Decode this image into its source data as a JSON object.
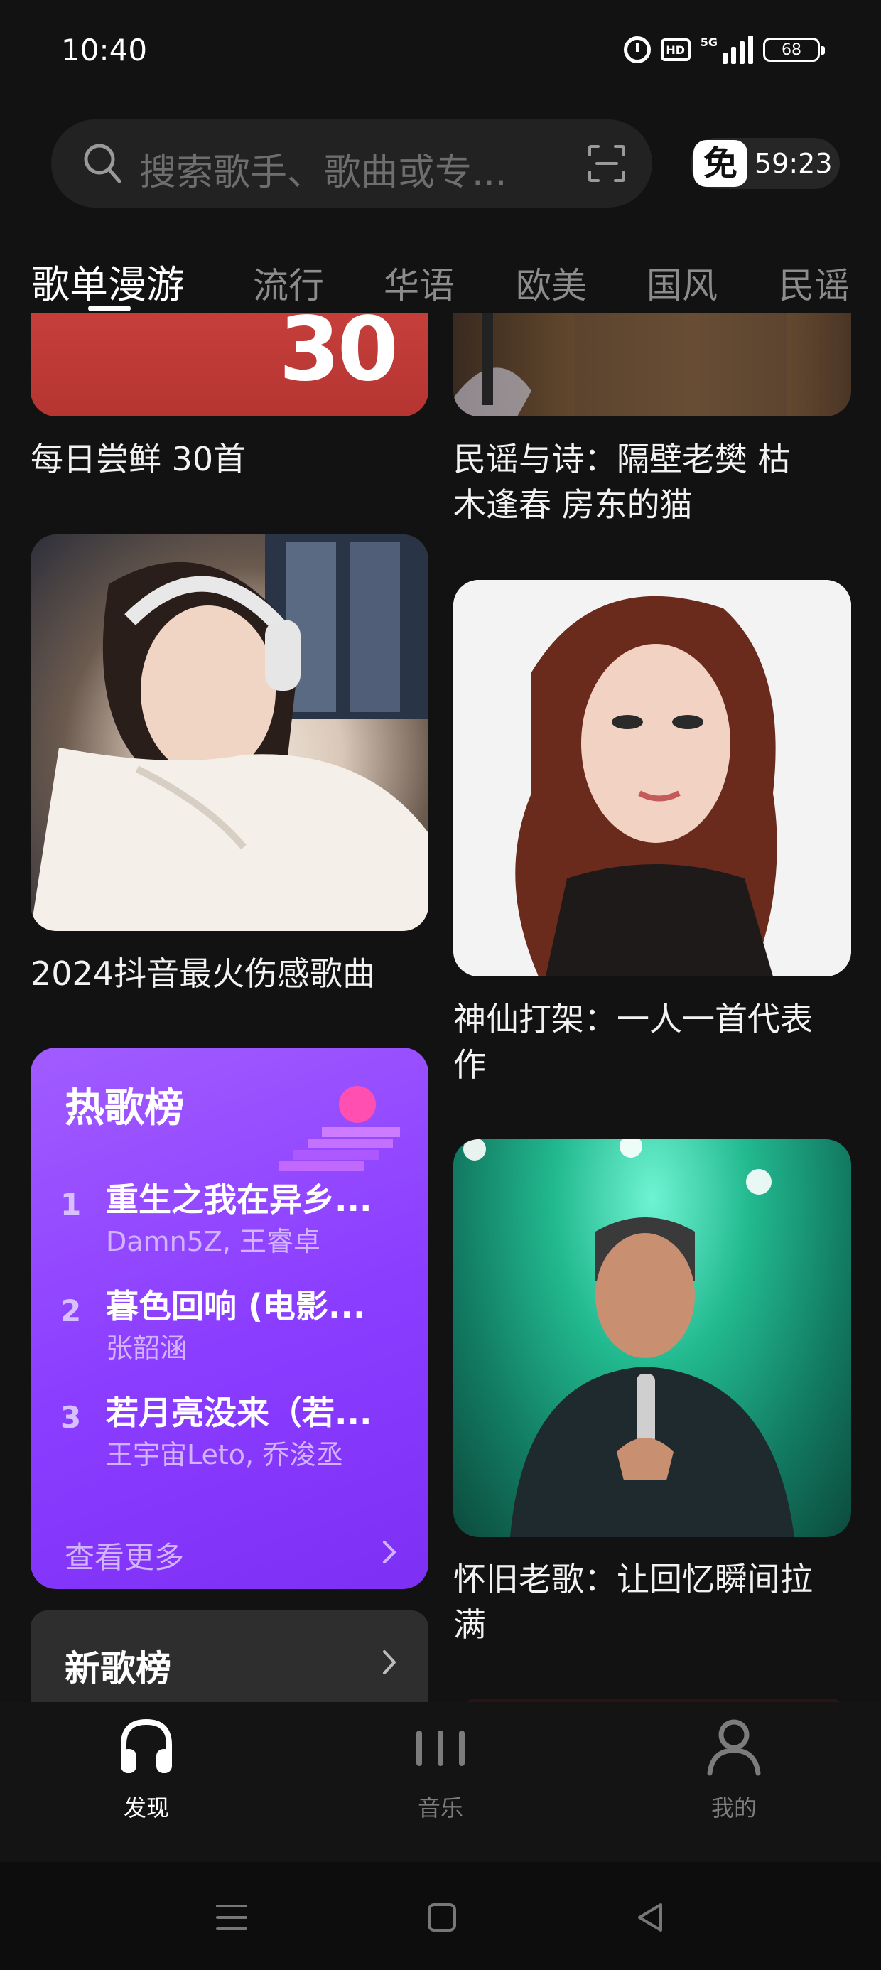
{
  "status": {
    "time": "10:40",
    "hd": "HD",
    "network": "5G",
    "battery": "68"
  },
  "search": {
    "placeholder": "搜索歌手、歌曲或专..."
  },
  "vip": {
    "badge": "免",
    "timer": "59:23"
  },
  "tabs": [
    {
      "label": "歌单漫游",
      "active": true
    },
    {
      "label": "流行"
    },
    {
      "label": "华语"
    },
    {
      "label": "欧美"
    },
    {
      "label": "国风"
    },
    {
      "label": "民谣"
    }
  ],
  "playlists": {
    "daily": {
      "cover_text": "30",
      "title": "每日尝鲜 30首"
    },
    "folk": {
      "title_line1": "民谣与诗：隔壁老樊 枯",
      "title_line2": "木逢春 房东的猫"
    },
    "sad": {
      "title": "2024抖音最火伤感歌曲"
    },
    "classic": {
      "title_line1": "神仙打架：一人一首代表",
      "title_line2": "作"
    },
    "oldsong": {
      "title_line1": "怀旧老歌：让回忆瞬间拉",
      "title_line2": "满"
    }
  },
  "hot_chart": {
    "title": "热歌榜",
    "items": [
      {
        "rank": "1",
        "song": "重生之我在异乡...",
        "artist": "Damn5Z, 王睿卓"
      },
      {
        "rank": "2",
        "song": "暮色回响 (电影...",
        "artist": "张韶涵"
      },
      {
        "rank": "3",
        "song": "若月亮没来（若...",
        "artist": "王宇宙Leto, 乔浚丞"
      }
    ],
    "more": "查看更多",
    "accent": "#8a3cff"
  },
  "new_chart": {
    "title": "新歌榜"
  },
  "bottom_nav": [
    {
      "label": "发现",
      "icon": "headphones-icon",
      "active": true
    },
    {
      "label": "音乐",
      "icon": "bars-icon"
    },
    {
      "label": "我的",
      "icon": "person-icon"
    }
  ]
}
